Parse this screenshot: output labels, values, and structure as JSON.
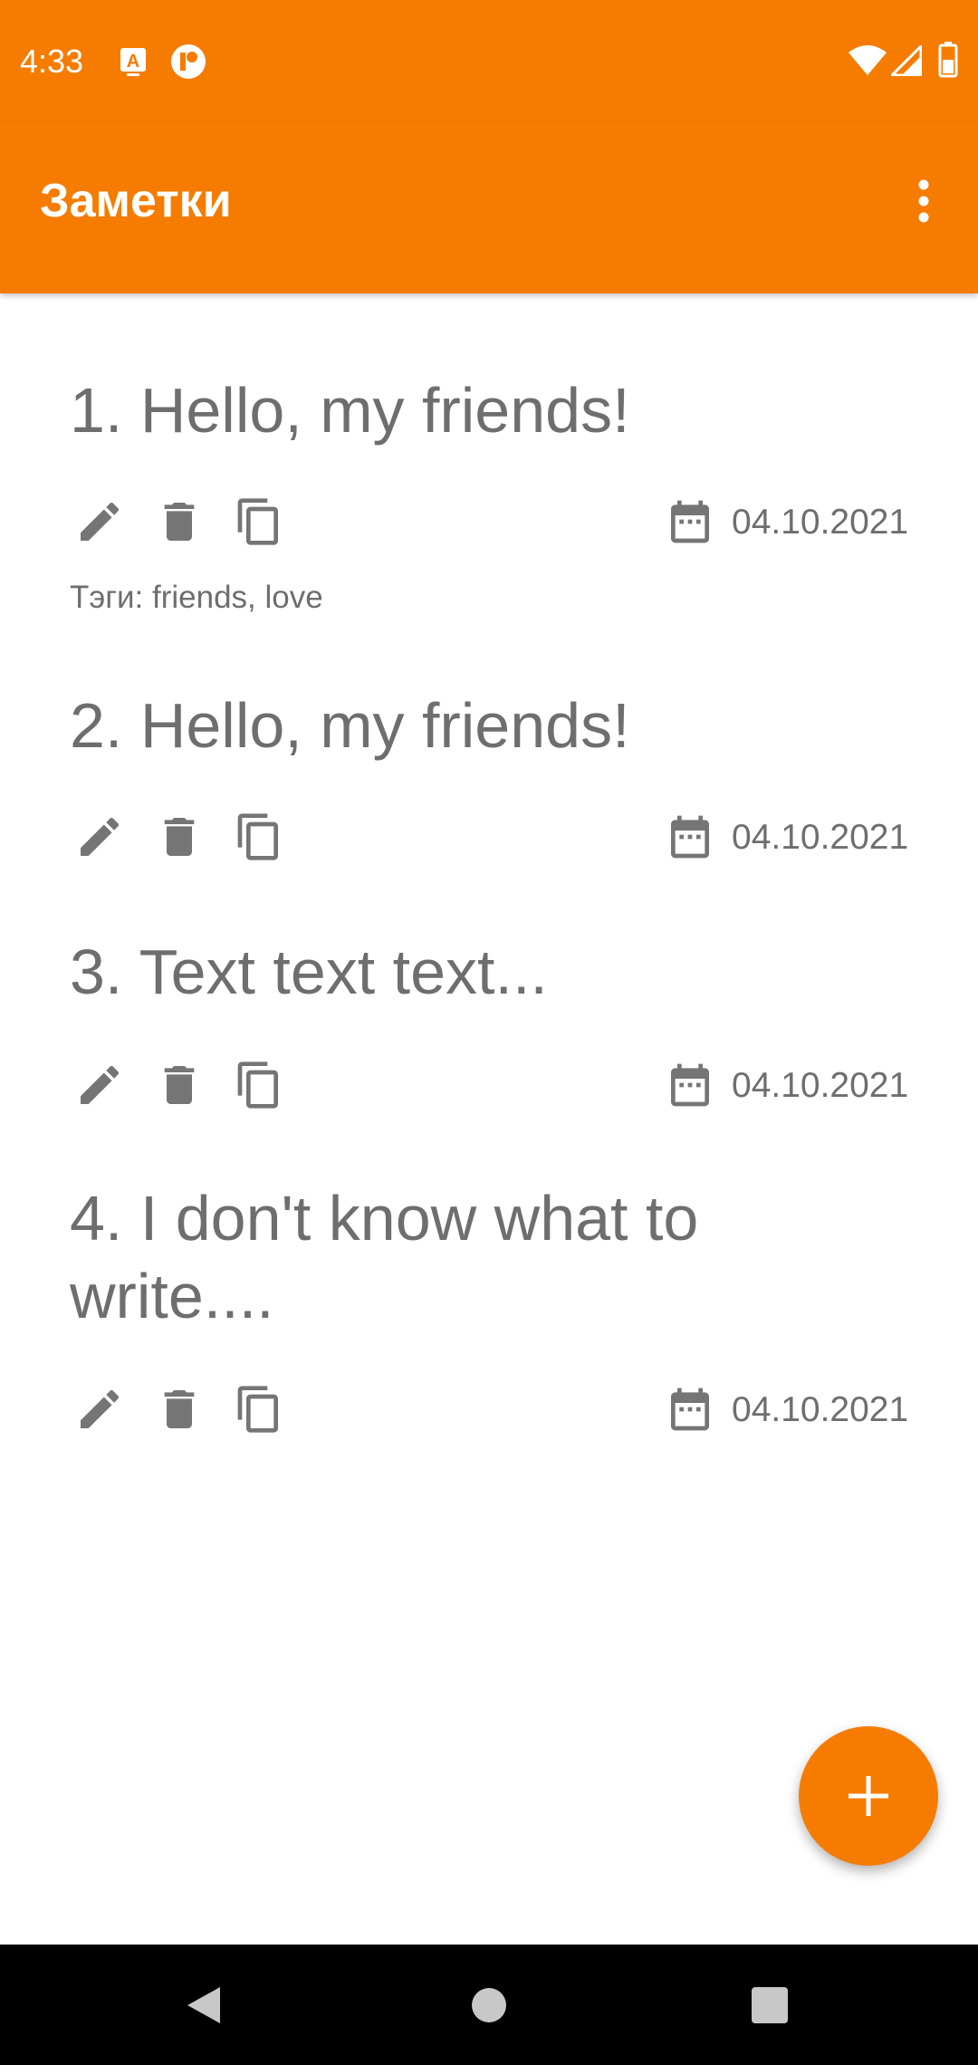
{
  "status_bar": {
    "time": "4:33",
    "icons": [
      "keyboard-notification-icon",
      "app-notification-icon",
      "wifi-icon",
      "signal-icon",
      "battery-icon"
    ]
  },
  "app_bar": {
    "title": "Заметки",
    "menu_icon": "more-vert-icon"
  },
  "notes": [
    {
      "title": "1. Hello, my friends!",
      "date": "04.10.2021",
      "tags": "Тэги: friends, love"
    },
    {
      "title": "2. Hello, my friends!",
      "date": "04.10.2021"
    },
    {
      "title": "3. Text text text...",
      "date": "04.10.2021"
    },
    {
      "title": "4. I don't know what to write....",
      "date": "04.10.2021"
    }
  ],
  "note_actions": [
    "edit-icon",
    "delete-icon",
    "copy-icon"
  ],
  "fab": {
    "icon": "plus-icon"
  },
  "nav_bar": {
    "icons": [
      "back-icon",
      "home-icon",
      "recents-icon"
    ]
  },
  "colors": {
    "primary": "#f57c00",
    "text_gray": "#6e6e6e",
    "icon_gray": "#757575",
    "nav_background": "#000000"
  }
}
